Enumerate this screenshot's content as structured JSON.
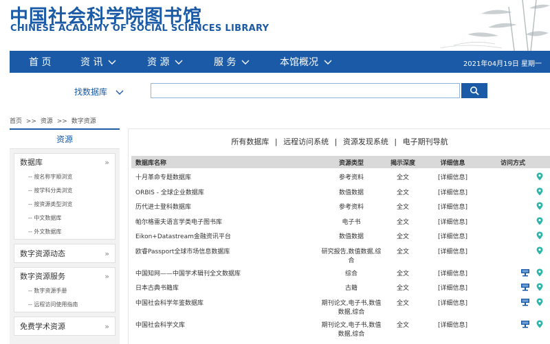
{
  "header": {
    "title_cn": "中国社会科学院图书馆",
    "title_en": "CHINESE ACADEMY OF SOCIAL SCIENCES LIBRARY"
  },
  "nav": {
    "items": [
      {
        "label": "首 页"
      },
      {
        "label": "资 讯"
      },
      {
        "label": "资 源"
      },
      {
        "label": "服 务"
      },
      {
        "label": "本馆概况"
      }
    ],
    "date": "2021年04月19日 星期一"
  },
  "search": {
    "label": "找数据库",
    "placeholder": ""
  },
  "breadcrumb": [
    "首页",
    ">>",
    "资源",
    ">>",
    "数字资源"
  ],
  "sidebar": {
    "title": "资源",
    "sections": [
      {
        "label": "数据库",
        "arrow": "»",
        "subs": [
          "-- 按名称字顺浏览",
          "-- 按学科分类浏览",
          "-- 按资源类型浏览",
          "-- 中文数据库",
          "-- 外文数据库"
        ]
      },
      {
        "label": "数字资源动态",
        "arrow": "»",
        "subs": []
      },
      {
        "label": "数字资源服务",
        "arrow": "»",
        "subs": [
          "-- 数字资源手册",
          "-- 远程访问使用指南"
        ]
      },
      {
        "label": "免费学术资源",
        "arrow": "»",
        "subs": []
      }
    ]
  },
  "tabs": [
    "所有数据库",
    "远程访问系统",
    "资源发现系统",
    "电子期刊导航"
  ],
  "table": {
    "headers": [
      "数据库名称",
      "资源类型",
      "揭示深度",
      "详细信息",
      "访问方式"
    ],
    "rows": [
      {
        "name": "十月革命专题数据库",
        "type": "参考资料",
        "depth": "全文",
        "info": "[详细信息]",
        "remote": false
      },
      {
        "name": "ORBIS - 全球企业数据库",
        "type": "数值数据",
        "depth": "全文",
        "info": "[详细信息]",
        "remote": false
      },
      {
        "name": "历代进士登科数据库",
        "type": "参考资料",
        "depth": "全文",
        "info": "[详细信息]",
        "remote": false
      },
      {
        "name": "帕尔格雷夫语言学类电子图书库",
        "type": "电子书",
        "depth": "全文",
        "info": "[详细信息]",
        "remote": false
      },
      {
        "name": "Eikon+Datastream金融资讯平台",
        "type": "数值数据",
        "depth": "全文",
        "info": "[详细信息]",
        "remote": false
      },
      {
        "name": "欧睿Passport全球市场信息数据库",
        "type": "研究报告,数值数据,综合",
        "depth": "全文",
        "info": "[详细信息]",
        "remote": false
      },
      {
        "name": "中国知网——中国学术辑刊全文数据库",
        "type": "综合",
        "depth": "全文",
        "info": "[详细信息]",
        "remote": true
      },
      {
        "name": "日本古典书籍库",
        "type": "古籍",
        "depth": "全文",
        "info": "[详细信息]",
        "remote": true
      },
      {
        "name": "中国社会科学年鉴数据库",
        "type": "期刊论文,电子书,数值数据,综合",
        "depth": "全文",
        "info": "[详细信息]",
        "remote": true
      },
      {
        "name": "中国社会科学文库",
        "type": "期刊论文,电子书,数值数据,综合",
        "depth": "全文",
        "info": "[详细信息]",
        "remote": true
      }
    ]
  },
  "colors": {
    "brand": "#1a5aa6",
    "pin": "#2bb5a8"
  }
}
